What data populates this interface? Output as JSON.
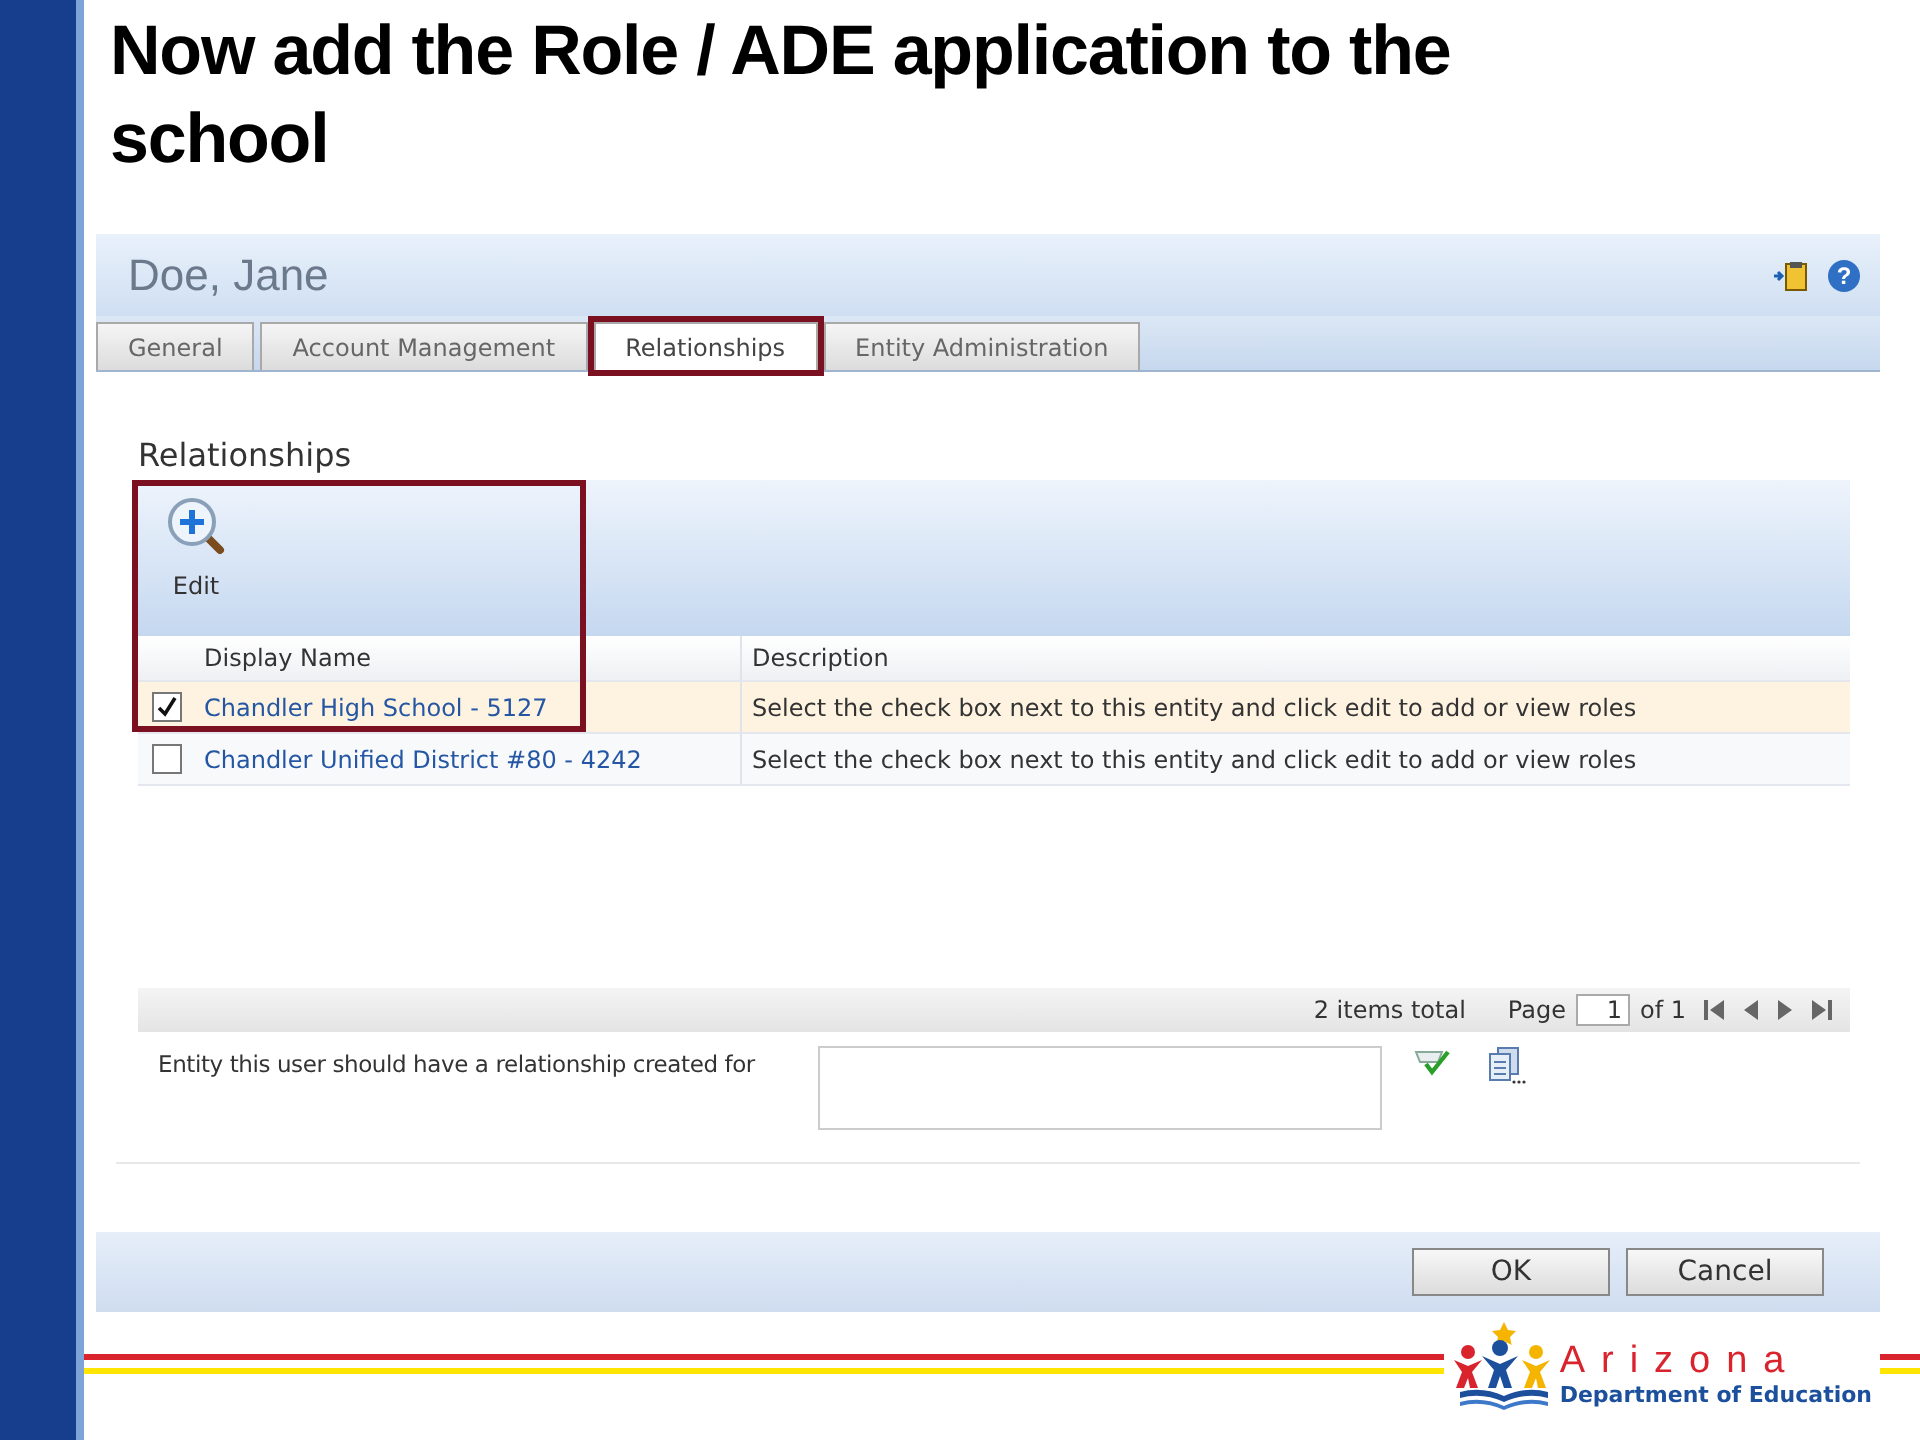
{
  "slide_title": "Now add the Role / ADE application to the school",
  "window": {
    "user_name": "Doe, Jane",
    "help_icon": "?"
  },
  "tabs": [
    {
      "label": "General",
      "selected": false,
      "highlighted": false
    },
    {
      "label": "Account Management",
      "selected": false,
      "highlighted": false
    },
    {
      "label": "Relationships",
      "selected": true,
      "highlighted": true
    },
    {
      "label": "Entity Administration",
      "selected": false,
      "highlighted": false
    }
  ],
  "section_title": "Relationships",
  "toolbar": {
    "edit_label": "Edit",
    "highlighted": true
  },
  "table": {
    "columns": [
      "Display Name",
      "Description"
    ],
    "rows": [
      {
        "display_name": "Chandler High School - 5127",
        "description": "Select the check box next to this entity and click edit to add or view roles",
        "checked": true,
        "selected": true
      },
      {
        "display_name": "Chandler Unified District #80 - 4242",
        "description": "Select the check box next to this entity and click edit to add or view roles",
        "checked": false,
        "selected": false
      }
    ]
  },
  "pager": {
    "total": "2 items total",
    "page_label": "Page",
    "page_value": "1",
    "of_label": "of 1"
  },
  "entity_field": {
    "label": "Entity this user should have a relationship created for"
  },
  "buttons": [
    "OK",
    "Cancel"
  ],
  "logo": {
    "name": "Arizona",
    "subtitle": "Department of Education"
  }
}
